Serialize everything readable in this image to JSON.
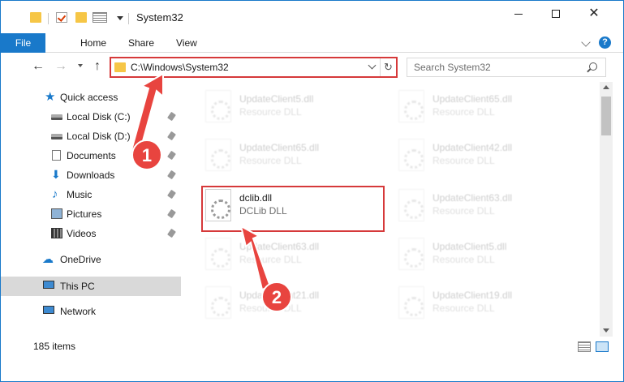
{
  "window": {
    "title": "System32"
  },
  "ribbon": {
    "tabs": [
      "File",
      "Home",
      "Share",
      "View"
    ],
    "help_label": "?"
  },
  "navigation": {
    "address_path": "C:\\Windows\\System32",
    "search_placeholder": "Search System32"
  },
  "sidebar": {
    "items": [
      {
        "label": "Quick access",
        "icon": "star-icon"
      },
      {
        "label": "Local Disk (C:)",
        "icon": "drive-icon",
        "pinned": true
      },
      {
        "label": "Local Disk (D:)",
        "icon": "drive-icon",
        "pinned": true
      },
      {
        "label": "Documents",
        "icon": "documents-icon",
        "pinned": true
      },
      {
        "label": "Downloads",
        "icon": "download-icon",
        "pinned": true
      },
      {
        "label": "Music",
        "icon": "music-icon",
        "pinned": true
      },
      {
        "label": "Pictures",
        "icon": "pictures-icon",
        "pinned": true
      },
      {
        "label": "Videos",
        "icon": "videos-icon",
        "pinned": true
      },
      {
        "label": "OneDrive",
        "icon": "cloud-icon"
      },
      {
        "label": "This PC",
        "icon": "computer-icon",
        "selected": true
      },
      {
        "label": "Network",
        "icon": "network-icon"
      }
    ]
  },
  "files": [
    {
      "name": "UpdateClient5.dll",
      "type": "Resource DLL"
    },
    {
      "name": "UpdateClient65.dll",
      "type": "Resource DLL"
    },
    {
      "name": "UpdateClient65.dll",
      "type": "Resource DLL"
    },
    {
      "name": "UpdateClient42.dll",
      "type": "Resource DLL"
    },
    {
      "name": "dclib.dll",
      "type": "DCLib DLL"
    },
    {
      "name": "UpdateClient63.dll",
      "type": "Resource DLL"
    },
    {
      "name": "UpdateClient63.dll",
      "type": "Resource DLL"
    },
    {
      "name": "UpdateClient5.dll",
      "type": "Resource DLL"
    },
    {
      "name": "UpdateClient21.dll",
      "type": "Resource DLL"
    },
    {
      "name": "UpdateClient19.dll",
      "type": "Resource DLL"
    }
  ],
  "status": {
    "item_count": "185 items"
  },
  "annotations": {
    "step1": "1",
    "step2": "2",
    "color": "#d6393a"
  }
}
